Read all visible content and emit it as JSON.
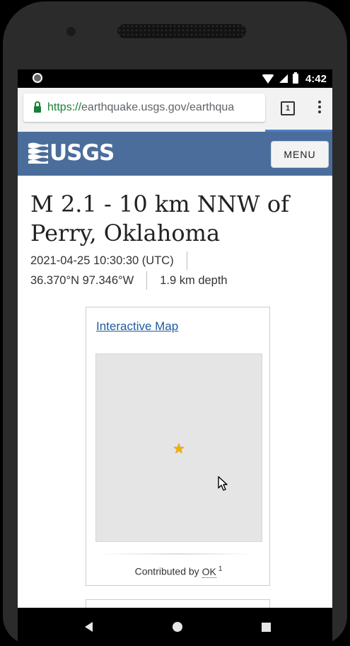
{
  "status_bar": {
    "time": "4:42"
  },
  "browser": {
    "url_scheme": "https://",
    "url_host": "earthquake.usgs.gov/earthqua",
    "tab_count": "1"
  },
  "header": {
    "logo_text": "USGS",
    "menu_label": "MENU"
  },
  "event": {
    "title": "M 2.1 - 10 km NNW of Perry, Oklahoma",
    "datetime": "2021-04-25 10:30:30 (UTC)",
    "coordinates": "36.370°N 97.346°W",
    "depth": "1.9 km depth"
  },
  "map_card": {
    "link_label": "Interactive Map",
    "contributed_prefix": "Contributed by",
    "contributor": "OK",
    "footnote": "1"
  },
  "colors": {
    "header_bg": "#4b6d9b",
    "link": "#1f5aa0",
    "secure": "#188038"
  }
}
